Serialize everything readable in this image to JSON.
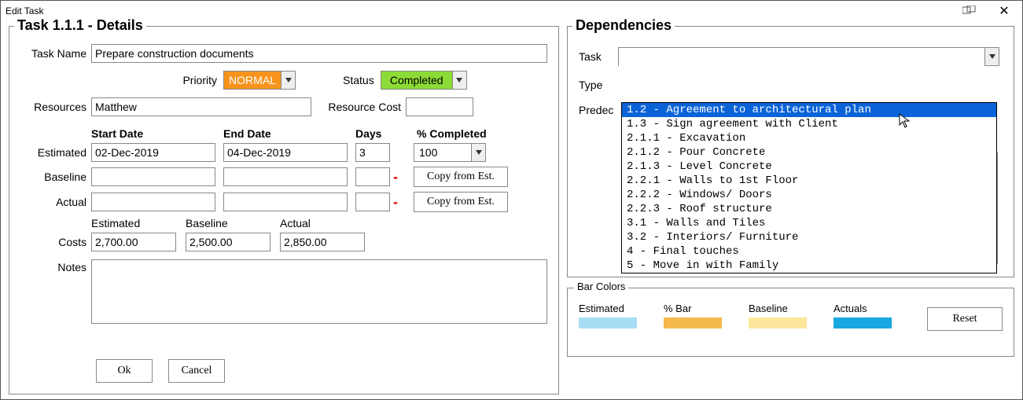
{
  "window": {
    "title": "Edit Task",
    "close": "✕"
  },
  "details": {
    "heading": "Task 1.1.1 - Details",
    "labels": {
      "taskName": "Task Name",
      "priority": "Priority",
      "status": "Status",
      "resources": "Resources",
      "resourceCost": "Resource Cost",
      "startDate": "Start Date",
      "endDate": "End Date",
      "days": "Days",
      "pctCompleted": "% Completed",
      "estimated": "Estimated",
      "baseline": "Baseline",
      "actual": "Actual",
      "costs": "Costs",
      "costEstimated": "Estimated",
      "costBaseline": "Baseline",
      "costActual": "Actual",
      "notes": "Notes"
    },
    "values": {
      "taskName": "Prepare construction documents",
      "priority": "NORMAL",
      "status": "Completed",
      "resources": "Matthew",
      "resourceCost": "",
      "est": {
        "start": "02-Dec-2019",
        "end": "04-Dec-2019",
        "days": "3",
        "pct": "100"
      },
      "baseline": {
        "start": "",
        "end": "",
        "days": ""
      },
      "actual": {
        "start": "",
        "end": "",
        "days": ""
      },
      "costs": {
        "estimated": "2,700.00",
        "baseline": "2,500.00",
        "actual": "2,850.00"
      },
      "notes": ""
    },
    "buttons": {
      "copyFromEst": "Copy from Est.",
      "ok": "Ok",
      "cancel": "Cancel"
    }
  },
  "dependencies": {
    "heading": "Dependencies",
    "labels": {
      "task": "Task",
      "type": "Type",
      "predecessors": "Predec"
    },
    "taskValue": "",
    "options": [
      "1.2 - Agreement to architectural plan",
      "1.3 - Sign agreement with Client",
      "2.1.1 - Excavation",
      "2.1.2 - Pour Concrete",
      "2.1.3 - Level Concrete",
      "2.2.1 - Walls to 1st Floor",
      "2.2.2 - Windows/ Doors",
      "2.2.3 - Roof structure",
      "3.1 - Walls and Tiles",
      "3.2 - Interiors/ Furniture",
      "4 - Final touches",
      "5 - Move in with Family"
    ],
    "selectedIndex": 0
  },
  "barColors": {
    "heading": "Bar Colors",
    "labels": {
      "estimated": "Estimated",
      "pctBar": "% Bar",
      "baseline": "Baseline",
      "actuals": "Actuals",
      "reset": "Reset"
    },
    "colors": {
      "estimated": "#A8DDF5",
      "pctBar": "#F4B94A",
      "baseline": "#FDE79C",
      "actuals": "#1AA7E2"
    }
  }
}
